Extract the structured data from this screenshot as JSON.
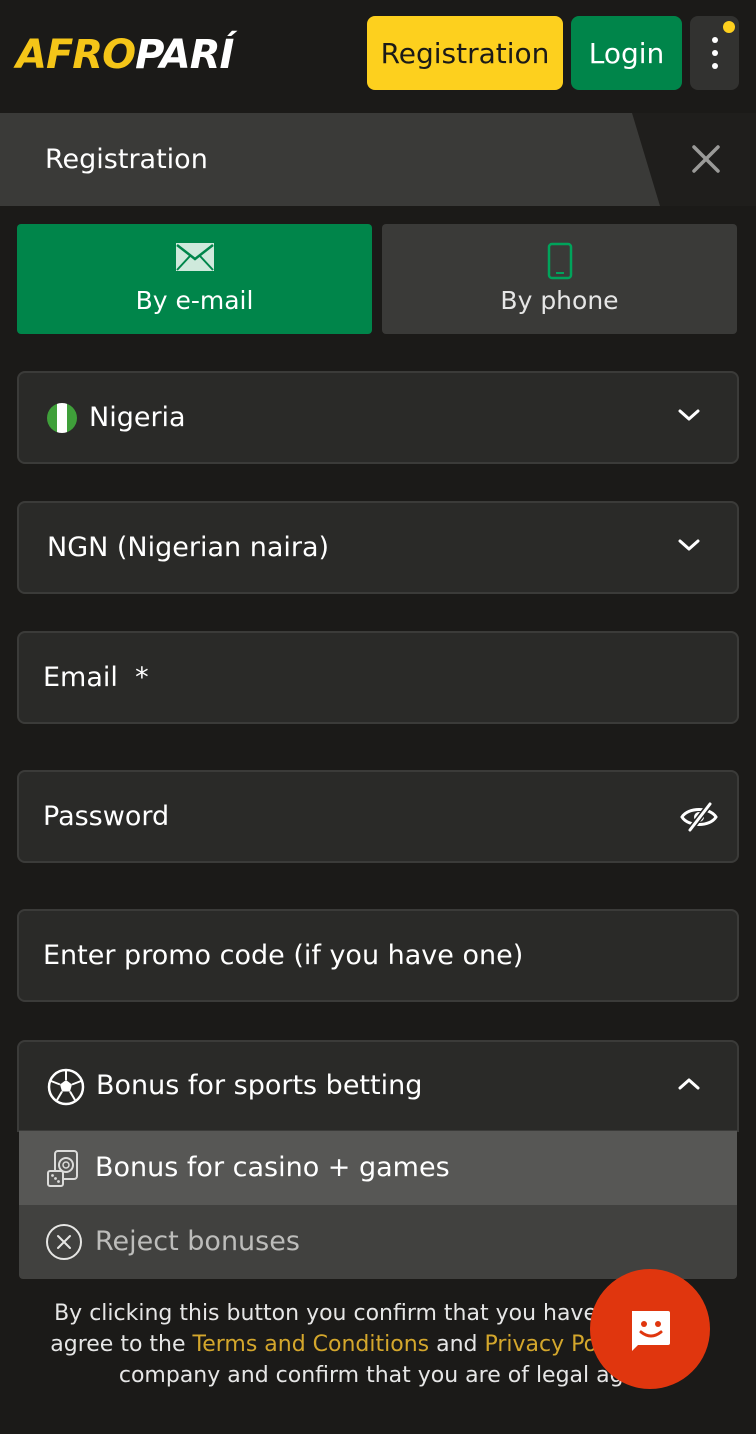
{
  "header": {
    "logo_part1": "AFRO",
    "logo_part2": "PARÍ",
    "registration_label": "Registration",
    "login_label": "Login",
    "menu_icon": "kebab-menu-icon",
    "notification_color": "#fdd01e"
  },
  "titlebar": {
    "title": "Registration",
    "close_icon": "close-icon"
  },
  "methods": {
    "email_label": "By e-mail",
    "phone_label": "By phone",
    "email_icon": "envelope-icon",
    "phone_icon": "smartphone-icon",
    "active": "By e-mail"
  },
  "form": {
    "country": "Nigeria",
    "currency": "NGN (Nigerian naira)",
    "email_label": "Email  *",
    "password_label": "Password",
    "promo_label": "Enter promo code (if you have one)"
  },
  "bonus": {
    "selected": "Bonus for sports betting",
    "options": [
      "Bonus for casino + games",
      "Reject bonuses"
    ]
  },
  "disclaimer": {
    "part1": "By clicking this button you confirm that you have read and agree to the ",
    "terms_link": "Terms and Conditions",
    "part2": " and ",
    "privacy_link": "Privacy Policy",
    "part3": " of the company and confirm that you are of legal age"
  },
  "colors": {
    "brand_yellow": "#fdd01e",
    "brand_green": "#00854a",
    "chat_red": "#e0360e",
    "link": "#d4a72c"
  }
}
